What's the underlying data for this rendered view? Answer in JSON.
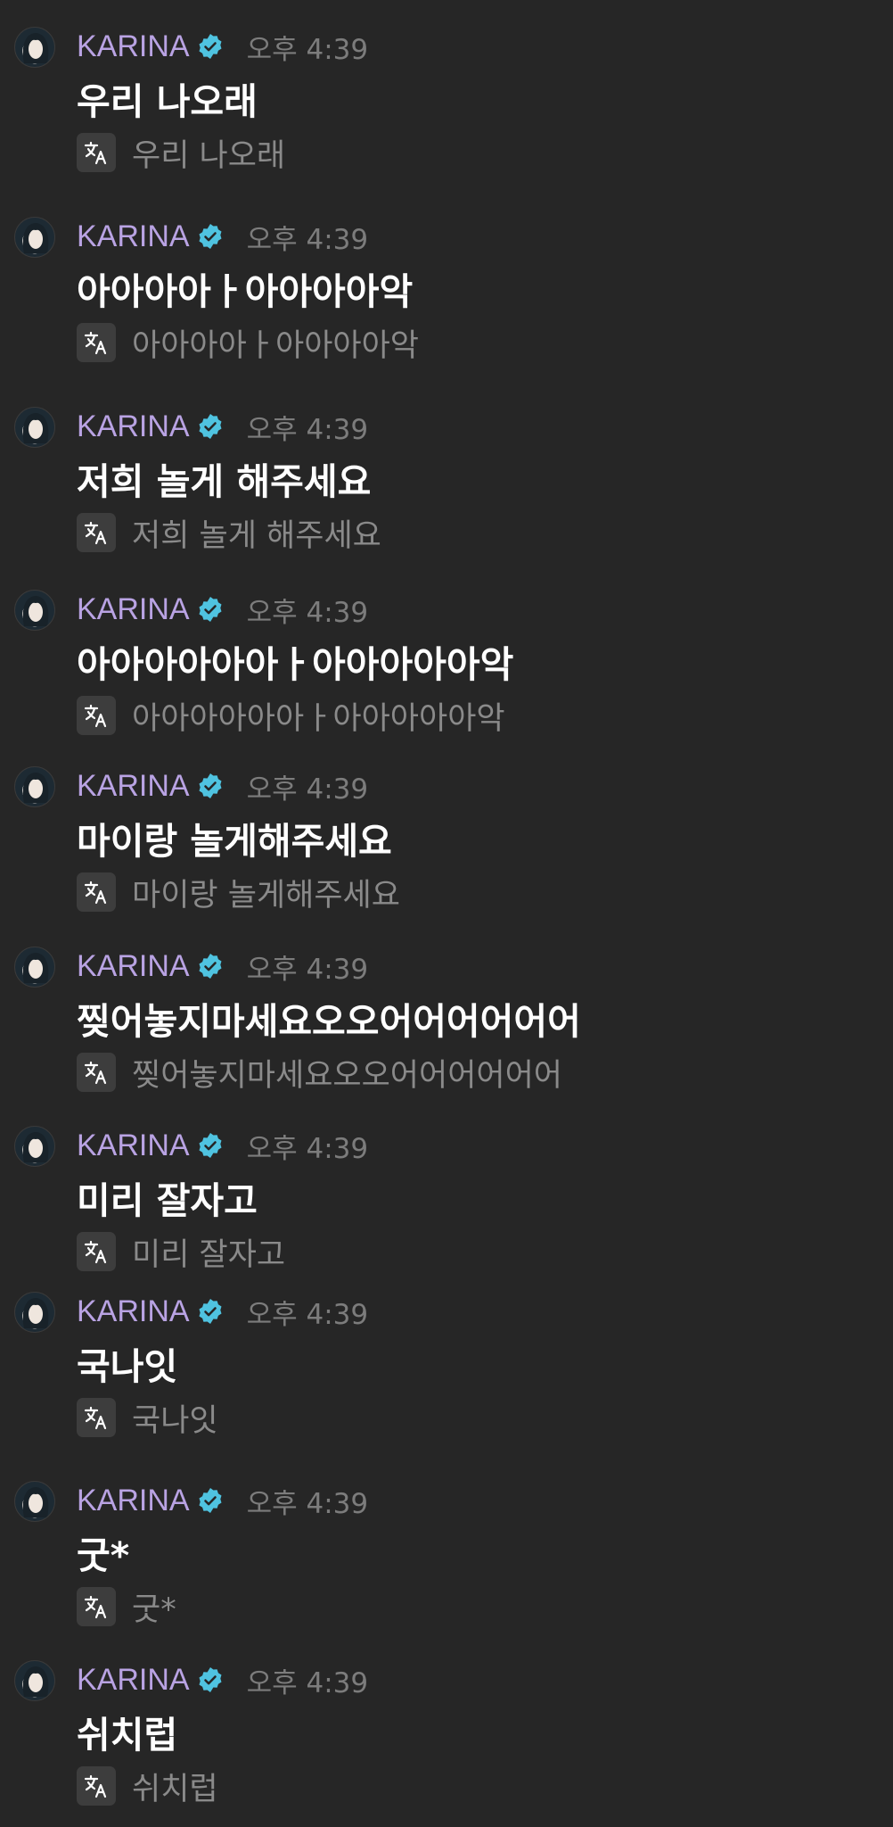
{
  "colors": {
    "background": "#262626",
    "username": "#b9a3e3",
    "verified_badge": "#4fc3e0",
    "timestamp": "#7c7c7c",
    "message_text": "#ffffff",
    "translation_text": "#8a8a8a"
  },
  "messages": [
    {
      "username": "KARINA",
      "verified_icon": "verified-badge-icon",
      "time": "오후 4:39",
      "text": "우리 나오래",
      "translation": "우리 나오래",
      "translate_icon": "translate-icon"
    },
    {
      "username": "KARINA",
      "verified_icon": "verified-badge-icon",
      "time": "오후 4:39",
      "text": "아아아아ㅏ아아아아악",
      "translation": "아아아아ㅏ아아아아악",
      "translate_icon": "translate-icon"
    },
    {
      "username": "KARINA",
      "verified_icon": "verified-badge-icon",
      "time": "오후 4:39",
      "text": "저희 놀게 해주세요",
      "translation": "저희 놀게 해주세요",
      "translate_icon": "translate-icon"
    },
    {
      "username": "KARINA",
      "verified_icon": "verified-badge-icon",
      "time": "오후 4:39",
      "text": "아아아아아아ㅏ아아아아아악",
      "translation": "아아아아아아ㅏ아아아아아악",
      "translate_icon": "translate-icon"
    },
    {
      "username": "KARINA",
      "verified_icon": "verified-badge-icon",
      "time": "오후 4:39",
      "text": "마이랑 놀게해주세요",
      "translation": "마이랑 놀게해주세요",
      "translate_icon": "translate-icon"
    },
    {
      "username": "KARINA",
      "verified_icon": "verified-badge-icon",
      "time": "오후 4:39",
      "text": "찢어놓지마세요오오어어어어어어",
      "translation": "찢어놓지마세요오오어어어어어어",
      "translate_icon": "translate-icon"
    },
    {
      "username": "KARINA",
      "verified_icon": "verified-badge-icon",
      "time": "오후 4:39",
      "text": "미리 잘자고",
      "translation": "미리 잘자고",
      "translate_icon": "translate-icon"
    },
    {
      "username": "KARINA",
      "verified_icon": "verified-badge-icon",
      "time": "오후 4:39",
      "text": "국나잇",
      "translation": "국나잇",
      "translate_icon": "translate-icon"
    },
    {
      "username": "KARINA",
      "verified_icon": "verified-badge-icon",
      "time": "오후 4:39",
      "text": "굿*",
      "translation": "굿*",
      "translate_icon": "translate-icon"
    },
    {
      "username": "KARINA",
      "verified_icon": "verified-badge-icon",
      "time": "오후 4:39",
      "text": "쉬치럽",
      "translation": "쉬치럽",
      "translate_icon": "translate-icon"
    }
  ]
}
